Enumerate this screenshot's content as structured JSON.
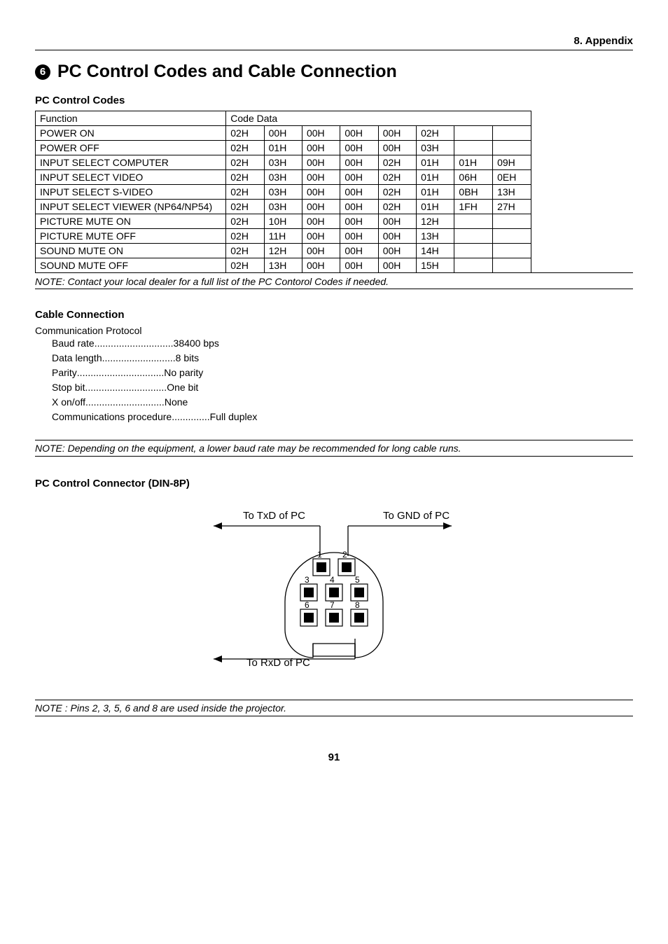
{
  "header": "8. Appendix",
  "section_number": "6",
  "title": "PC Control Codes and Cable Connection",
  "pc_control_codes": {
    "heading": "PC Control Codes",
    "headers": [
      "Function",
      "Code Data"
    ],
    "rows": [
      {
        "func": "POWER ON",
        "codes": [
          "02H",
          "00H",
          "00H",
          "00H",
          "00H",
          "02H",
          "",
          ""
        ]
      },
      {
        "func": "POWER OFF",
        "codes": [
          "02H",
          "01H",
          "00H",
          "00H",
          "00H",
          "03H",
          "",
          ""
        ]
      },
      {
        "func": "INPUT SELECT COMPUTER",
        "codes": [
          "02H",
          "03H",
          "00H",
          "00H",
          "02H",
          "01H",
          "01H",
          "09H"
        ]
      },
      {
        "func": "INPUT SELECT VIDEO",
        "codes": [
          "02H",
          "03H",
          "00H",
          "00H",
          "02H",
          "01H",
          "06H",
          "0EH"
        ]
      },
      {
        "func": "INPUT SELECT S-VIDEO",
        "codes": [
          "02H",
          "03H",
          "00H",
          "00H",
          "02H",
          "01H",
          "0BH",
          "13H"
        ]
      },
      {
        "func": "INPUT SELECT VIEWER (NP64/NP54)",
        "codes": [
          "02H",
          "03H",
          "00H",
          "00H",
          "02H",
          "01H",
          "1FH",
          "27H"
        ]
      },
      {
        "func": "PICTURE MUTE ON",
        "codes": [
          "02H",
          "10H",
          "00H",
          "00H",
          "00H",
          "12H",
          "",
          ""
        ]
      },
      {
        "func": "PICTURE MUTE OFF",
        "codes": [
          "02H",
          "11H",
          "00H",
          "00H",
          "00H",
          "13H",
          "",
          ""
        ]
      },
      {
        "func": "SOUND MUTE ON",
        "codes": [
          "02H",
          "12H",
          "00H",
          "00H",
          "00H",
          "14H",
          "",
          ""
        ]
      },
      {
        "func": "SOUND MUTE OFF",
        "codes": [
          "02H",
          "13H",
          "00H",
          "00H",
          "00H",
          "15H",
          "",
          ""
        ]
      }
    ],
    "note": "NOTE: Contact your local dealer for a full list of the PC Contorol Codes if needed."
  },
  "cable_connection": {
    "heading": "Cable Connection",
    "subheading": "Communication Protocol",
    "rows": [
      {
        "label": "Baud rate",
        "value": "38400 bps"
      },
      {
        "label": "Data length",
        "value": "8 bits"
      },
      {
        "label": "Parity",
        "value": "No parity"
      },
      {
        "label": "Stop bit",
        "value": "One bit"
      },
      {
        "label": "X on/off ",
        "value": "None"
      },
      {
        "label": "Communications procedure",
        "value": "Full duplex"
      }
    ],
    "note": "NOTE: Depending on the equipment, a lower baud rate may be recommended for long cable runs."
  },
  "connector": {
    "heading": "PC Control Connector (DIN-8P)",
    "label_txd": "To TxD of PC",
    "label_gnd": "To GND of PC",
    "label_rxd": "To RxD of PC",
    "pins": [
      "1",
      "2",
      "3",
      "4",
      "5",
      "6",
      "7",
      "8"
    ],
    "note": "NOTE : Pins 2, 3, 5, 6 and 8 are used inside the projector."
  },
  "page_number": "91"
}
